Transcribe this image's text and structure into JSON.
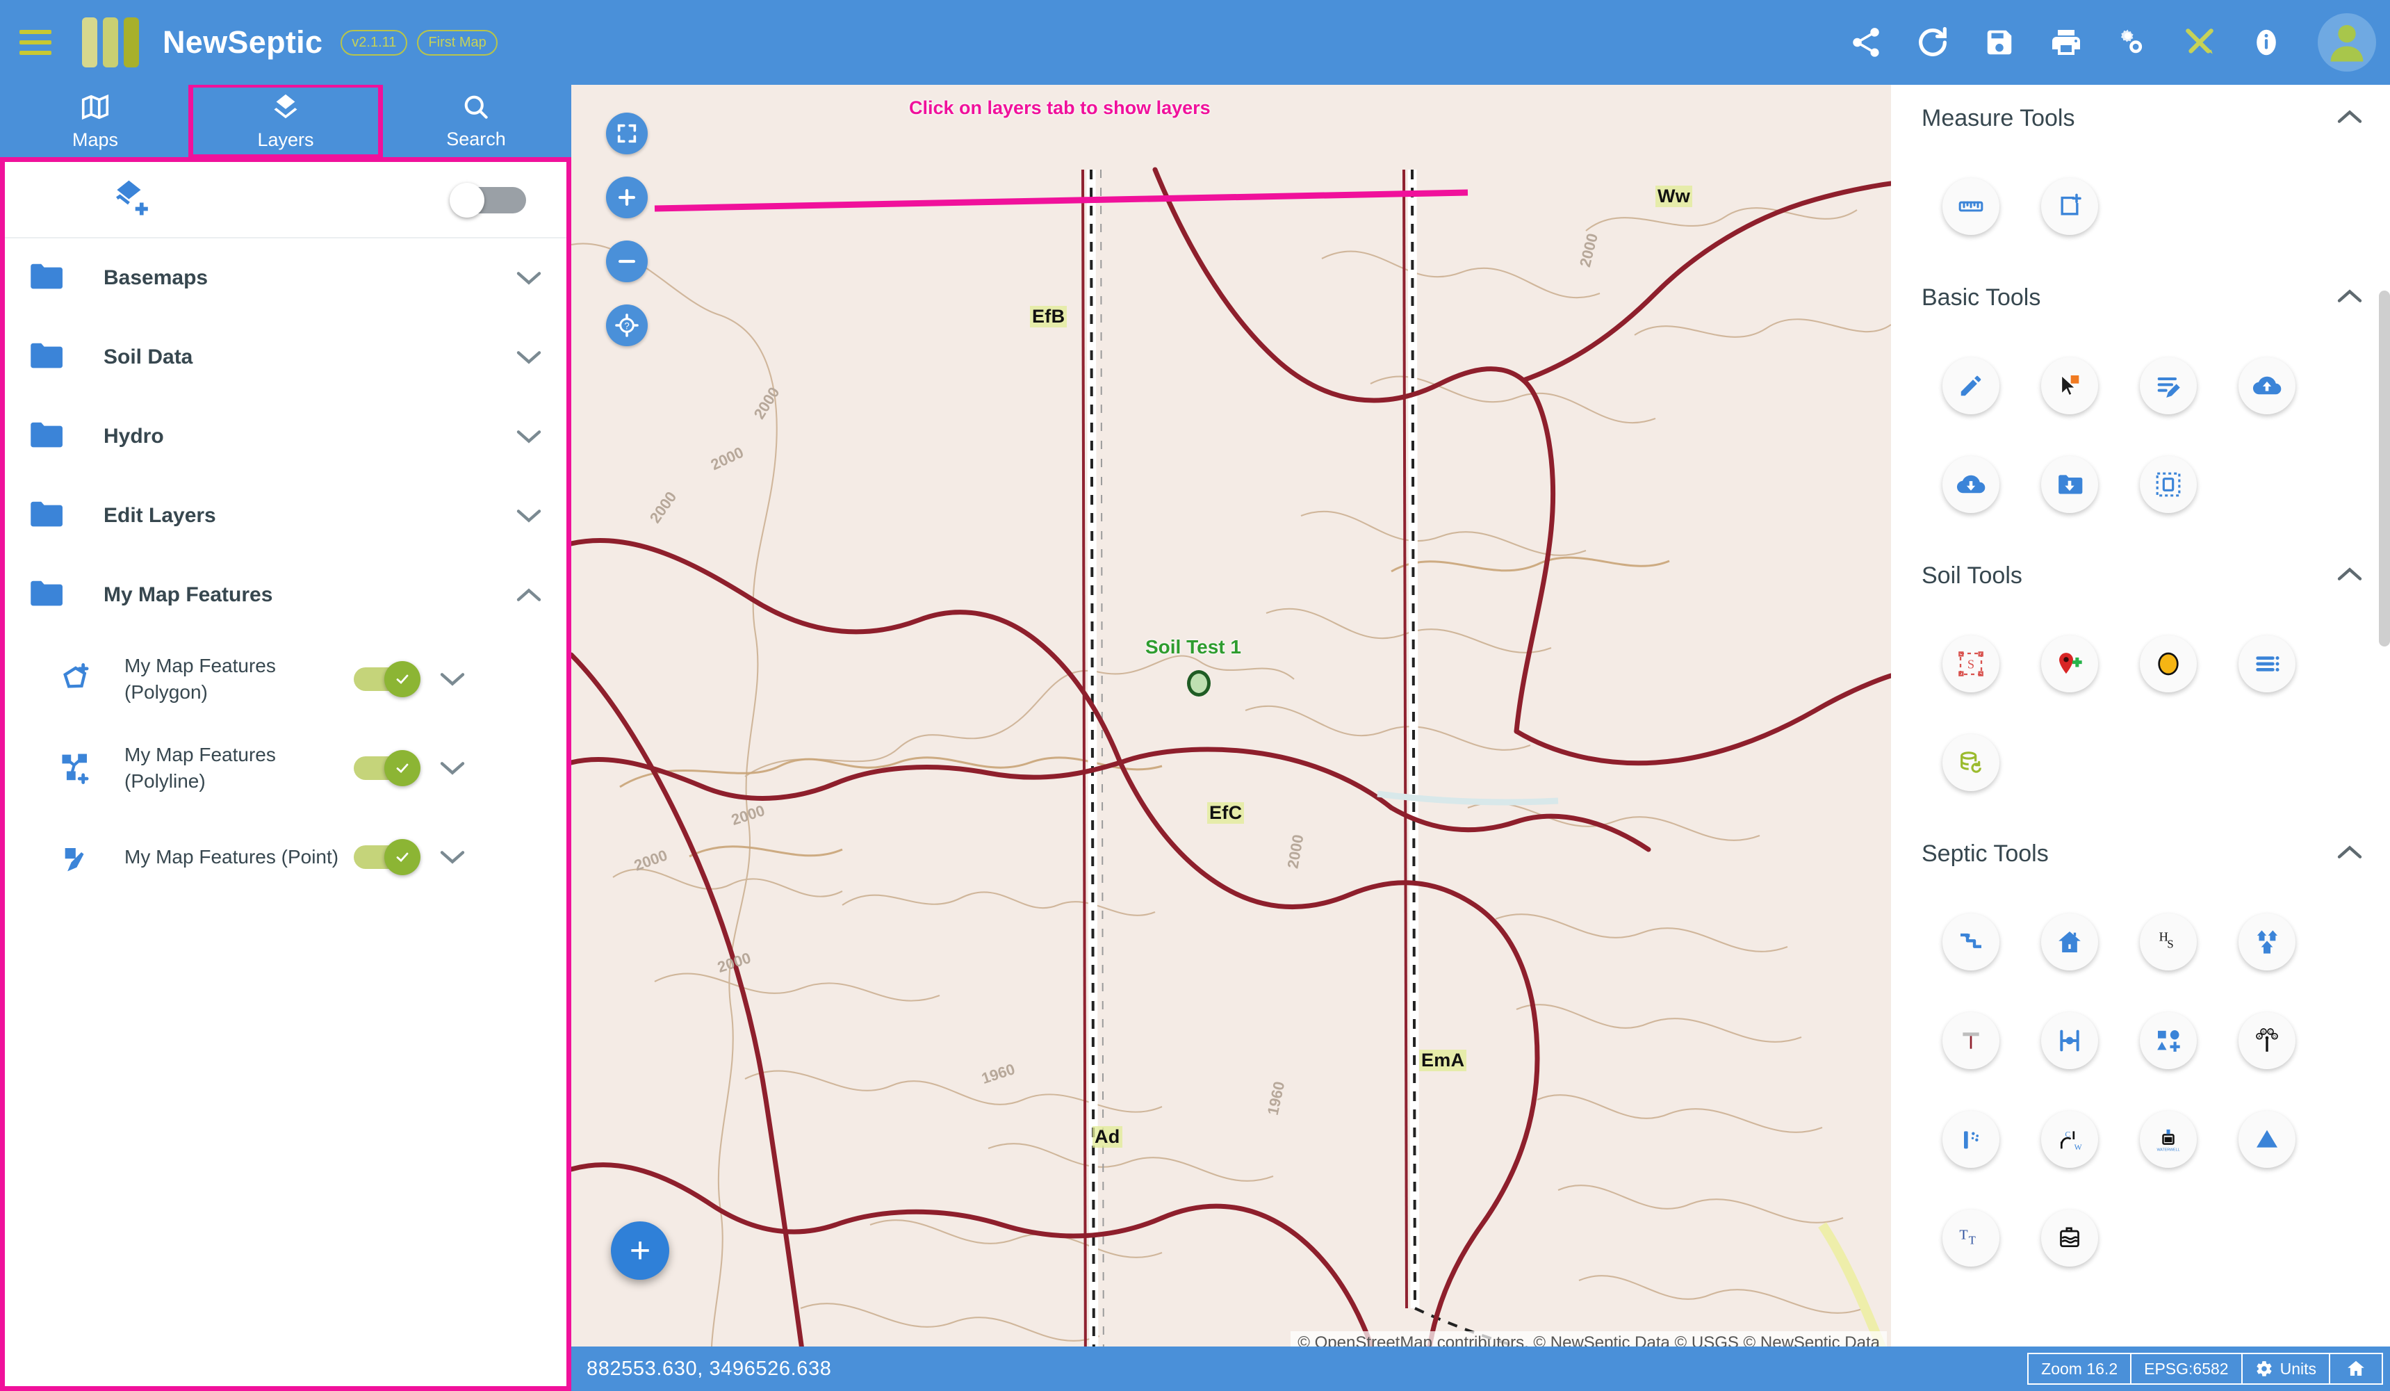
{
  "app": {
    "brand": "NewSeptic",
    "version_chip": "v2.1.11",
    "map_chip": "First Map",
    "menu_icon": "hamburger-menu-icon",
    "logo_icon": "newseptic-bars-logo",
    "actions": [
      {
        "name": "share-icon",
        "label": "Share"
      },
      {
        "name": "refresh-icon",
        "label": "Refresh"
      },
      {
        "name": "save-icon",
        "label": "Save"
      },
      {
        "name": "print-icon",
        "label": "Print"
      },
      {
        "name": "settings-gears-icon",
        "label": "Settings"
      },
      {
        "name": "tools-icon",
        "label": "Tools"
      },
      {
        "name": "info-icon",
        "label": "Info"
      }
    ],
    "avatar": "user-avatar"
  },
  "tabs": [
    {
      "label": "Maps",
      "icon": "map-icon",
      "active": false
    },
    {
      "label": "Layers",
      "icon": "layers-icon",
      "active": true
    },
    {
      "label": "Search",
      "icon": "search-icon",
      "active": false
    }
  ],
  "annotation": {
    "text": "Click on layers tab to show layers",
    "color": "#f0119b"
  },
  "layers_panel": {
    "add_layer_icon": "add-layer-icon",
    "master_toggle": "off",
    "groups": [
      {
        "label": "Basemaps",
        "expanded": false
      },
      {
        "label": "Soil Data",
        "expanded": false
      },
      {
        "label": "Hydro",
        "expanded": false
      },
      {
        "label": "Edit Layers",
        "expanded": false
      },
      {
        "label": "My Map Features",
        "expanded": true
      }
    ],
    "sublayers": [
      {
        "label": "My Map Features (Polygon)",
        "icon": "polygon-add-icon",
        "visible": true
      },
      {
        "label": "My Map Features (Polyline)",
        "icon": "polyline-add-icon",
        "visible": true
      },
      {
        "label": "My Map Features (Point)",
        "icon": "point-edit-icon",
        "visible": true
      }
    ]
  },
  "map": {
    "controls": [
      {
        "name": "fullscreen-icon",
        "label": "Fullscreen"
      },
      {
        "name": "zoom-in-icon",
        "label": "+"
      },
      {
        "name": "zoom-out-icon",
        "label": "−"
      },
      {
        "name": "locate-icon",
        "label": "Locate"
      }
    ],
    "fab_label": "+",
    "attribution": "© OpenStreetMap contributors. © NewSeptic Data © USGS © NewSeptic Data",
    "feature_label": "Soil Test 1",
    "soil_labels": [
      "EfB",
      "EfC",
      "Ad",
      "EmA",
      "Ww"
    ],
    "contour_labels": [
      "2000",
      "2000",
      "2000",
      "2000",
      "2000",
      "2000",
      "2000",
      "2000",
      "1960",
      "1960"
    ]
  },
  "status_bar": {
    "coordinates": "882553.630, 3496526.638",
    "zoom": "Zoom 16.2",
    "epsg": "EPSG:6582",
    "units": "Units",
    "units_icon": "gear-icon",
    "home_icon": "home-icon"
  },
  "tool_panel": {
    "sections": [
      {
        "title": "Measure Tools",
        "expanded": true,
        "tools": [
          {
            "name": "measure-distance-icon",
            "label": "Measure Distance"
          },
          {
            "name": "measure-area-icon",
            "label": "Measure Area"
          }
        ]
      },
      {
        "title": "Basic Tools",
        "expanded": true,
        "tools": [
          {
            "name": "draw-pencil-icon",
            "label": "Draw"
          },
          {
            "name": "select-feature-icon",
            "label": "Select Feature"
          },
          {
            "name": "edit-attributes-icon",
            "label": "Edit Attributes"
          },
          {
            "name": "cloud-upload-icon",
            "label": "Upload"
          },
          {
            "name": "cloud-download-icon",
            "label": "Download"
          },
          {
            "name": "folder-download-icon",
            "label": "Save to Folder"
          },
          {
            "name": "select-box-icon",
            "label": "Box Select"
          }
        ]
      },
      {
        "title": "Soil Tools",
        "expanded": true,
        "tools": [
          {
            "name": "soil-boundary-icon",
            "label": "Soil Boundary"
          },
          {
            "name": "add-soil-pin-icon",
            "label": "Add Soil Point"
          },
          {
            "name": "soil-circle-icon",
            "label": "Soil Symbol"
          },
          {
            "name": "soil-legend-list-icon",
            "label": "Soil Legend"
          },
          {
            "name": "soil-database-refresh-icon",
            "label": "Refresh Soil Data"
          }
        ]
      },
      {
        "title": "Septic Tools",
        "expanded": true,
        "tools": [
          {
            "name": "septic-line-icon",
            "label": "Septic Line"
          },
          {
            "name": "house-icon",
            "label": "House"
          },
          {
            "name": "house-setback-icon",
            "label": "House Setback"
          },
          {
            "name": "multi-house-icon",
            "label": "Multiple Houses"
          },
          {
            "name": "test-pit-icon",
            "label": "Test Pit"
          },
          {
            "name": "trench-icon",
            "label": "Trench"
          },
          {
            "name": "shapes-add-icon",
            "label": "Add Shapes"
          },
          {
            "name": "perc-test-icon",
            "label": "Perc Test"
          },
          {
            "name": "boring-icon",
            "label": "Boring"
          },
          {
            "name": "cw-line-icon",
            "label": "CW Line"
          },
          {
            "name": "waterwell-icon",
            "label": "Water Well",
            "caption": "WATERWELL"
          },
          {
            "name": "triangle-icon",
            "label": "Triangle Marker"
          },
          {
            "name": "text-label-icon",
            "label": "Text Label"
          },
          {
            "name": "tank-icon",
            "label": "Tank"
          }
        ]
      }
    ]
  }
}
